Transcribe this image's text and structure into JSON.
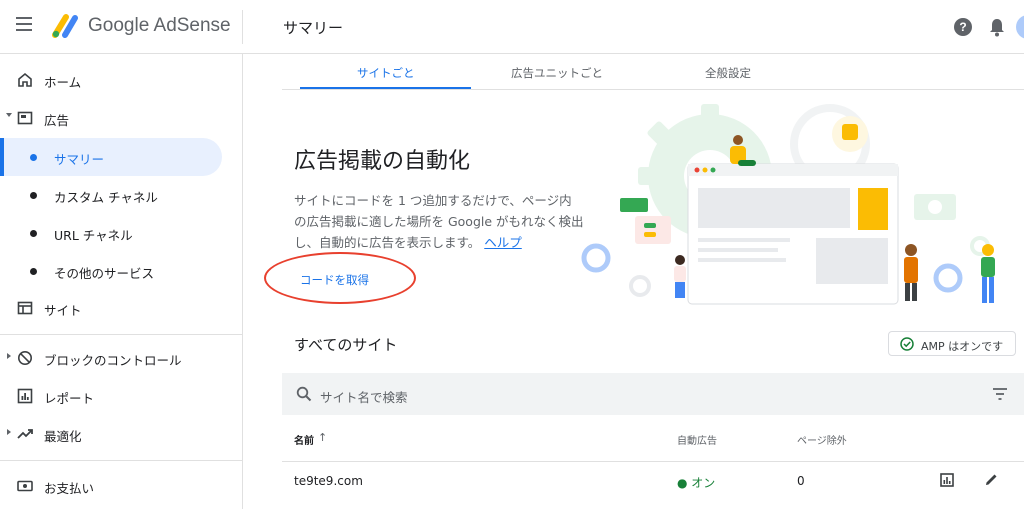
{
  "header": {
    "brand_google": "Google",
    "brand_product": "AdSense",
    "page_title": "サマリー",
    "help_glyph": "?"
  },
  "sidebar": {
    "items": [
      {
        "label": "ホーム",
        "icon": "home-icon"
      },
      {
        "label": "広告",
        "icon": "ads-icon",
        "expanded": true
      },
      {
        "label": "サイト",
        "icon": "sites-icon"
      },
      {
        "label": "ブロックのコントロール",
        "icon": "block-icon"
      },
      {
        "label": "レポート",
        "icon": "reports-icon"
      },
      {
        "label": "最適化",
        "icon": "optimize-icon"
      },
      {
        "label": "お支払い",
        "icon": "payments-icon"
      }
    ],
    "ads_subitems": [
      {
        "label": "サマリー",
        "active": true
      },
      {
        "label": "カスタム チャネル"
      },
      {
        "label": "URL チャネル"
      },
      {
        "label": "その他のサービス"
      }
    ]
  },
  "tabs": [
    {
      "label": "サイトごと",
      "active": true
    },
    {
      "label": "広告ユニットごと"
    },
    {
      "label": "全般設定"
    }
  ],
  "auto_ads": {
    "title": "広告掲載の自動化",
    "description": "サイトにコードを 1 つ追加するだけで、ページ内の広告掲載に適した場所を Google がもれなく検出し、自動的に広告を表示します。",
    "help_link": "ヘルプ",
    "get_code": "コードを取得"
  },
  "sites": {
    "title": "すべてのサイト",
    "amp_chip": "AMP はオンです",
    "search_placeholder": "サイト名で検索",
    "columns": {
      "name": "名前",
      "sort": "↑",
      "auto_ads": "自動広告",
      "page_exclusions": "ページ除外"
    },
    "rows": [
      {
        "name": "te9te9.com",
        "auto_ads": "● オン",
        "page_exclusions": "0"
      }
    ]
  },
  "colors": {
    "accent": "#1a73e8",
    "active_bg": "#e8f0fe",
    "annotation_circle": "#e8402e",
    "status_on": "#188038"
  }
}
